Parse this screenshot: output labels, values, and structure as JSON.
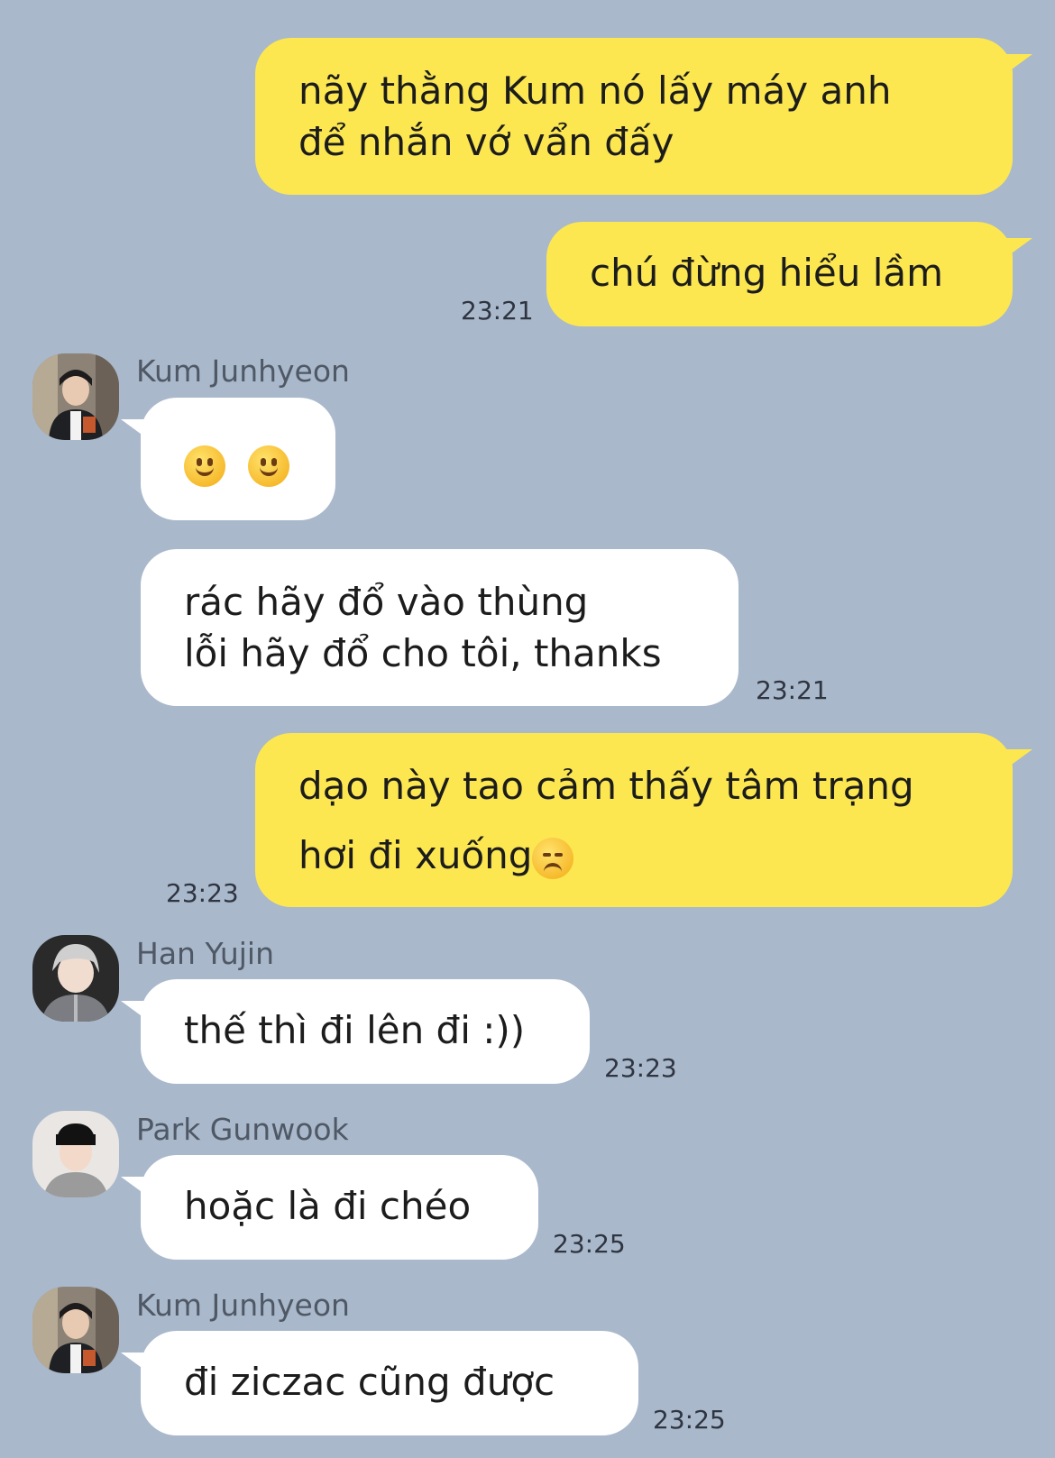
{
  "messages": [
    {
      "from": "me",
      "lines": [
        "nãy thằng Kum nó lấy máy anh",
        "để nhắn vớ vẩn đấy"
      ]
    },
    {
      "from": "me",
      "lines": [
        "chú đừng hiểu lầm"
      ],
      "time": "23:21"
    },
    {
      "from": "Kum Junhyeon",
      "sender": "Kum Junhyeon",
      "emoji": [
        "slightly-smiling-face",
        "slightly-smiling-face"
      ]
    },
    {
      "from": "Kum Junhyeon",
      "lines": [
        "rác hãy đổ vào thùng",
        "lỗi hãy đổ cho tôi, thanks"
      ],
      "time": "23:21"
    },
    {
      "from": "me",
      "lines": [
        "dạo này tao cảm thấy tâm trạng",
        "hơi đi xuống"
      ],
      "trailing_emoji": "disappointed-face",
      "time": "23:23"
    },
    {
      "from": "Han Yujin",
      "sender": "Han Yujin",
      "lines": [
        "thế thì đi lên đi :))"
      ],
      "time": "23:23"
    },
    {
      "from": "Park Gunwook",
      "sender": "Park Gunwook",
      "lines": [
        "hoặc là đi chéo"
      ],
      "time": "23:25"
    },
    {
      "from": "Kum Junhyeon",
      "sender": "Kum Junhyeon",
      "lines": [
        "đi ziczac cũng được"
      ],
      "time": "23:25"
    }
  ],
  "colors": {
    "background": "#a9b8cb",
    "my_bubble": "#fce751",
    "their_bubble": "#ffffff"
  }
}
